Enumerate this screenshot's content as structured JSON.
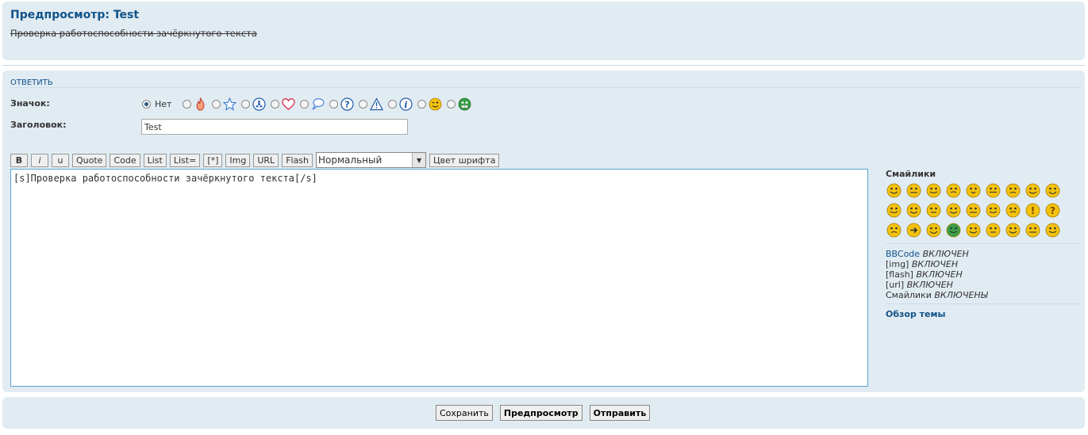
{
  "preview": {
    "title": "Предпросмотр: Test",
    "body": "Проверка работоспособности зачёркнутого текста"
  },
  "reply": {
    "heading": "ОТВЕТИТЬ",
    "icon_label": "Значок:",
    "none_label": "Нет",
    "icons": [
      "none",
      "fire-icon",
      "star-icon",
      "radioactive-icon",
      "heart-icon",
      "speech-bubble-icon",
      "question-icon",
      "warning-icon",
      "info-icon",
      "smiley-wink-icon",
      "grin-icon"
    ],
    "subject_label": "Заголовок:",
    "subject_value": "Test"
  },
  "toolbar": {
    "bold": "B",
    "italic": "i",
    "underline": "u",
    "quote": "Quote",
    "code": "Code",
    "list": "List",
    "list_eq": "List=",
    "list_item": "[*]",
    "img": "Img",
    "url": "URL",
    "flash": "Flash",
    "font_size": "Нормальный",
    "font_color": "Цвет шрифта"
  },
  "message": {
    "text": "[s]Проверка работоспособности зачёркнутого текста[/s]"
  },
  "sidebar": {
    "smilies_title": "Смайлики",
    "smilies_count": 27,
    "bbcode_label": "BBCode",
    "bbcode_state": "ВКЛЮЧЕН",
    "img_label": "[img]",
    "img_state": "ВКЛЮЧЕН",
    "flash_label": "[flash]",
    "flash_state": "ВКЛЮЧЕН",
    "url_label": "[url]",
    "url_state": "ВКЛЮЧЕН",
    "smilies_label": "Смайлики",
    "smilies_state": "ВКЛЮЧЕНЫ",
    "topic_review": "Обзор темы"
  },
  "actions": {
    "save": "Сохранить",
    "preview": "Предпросмотр",
    "submit": "Отправить"
  },
  "colors": {
    "panel_bg": "#e1ebf2",
    "link": "#105289",
    "textarea_border": "#5aa5d0",
    "smiley_yellow": "#f4c20d"
  }
}
